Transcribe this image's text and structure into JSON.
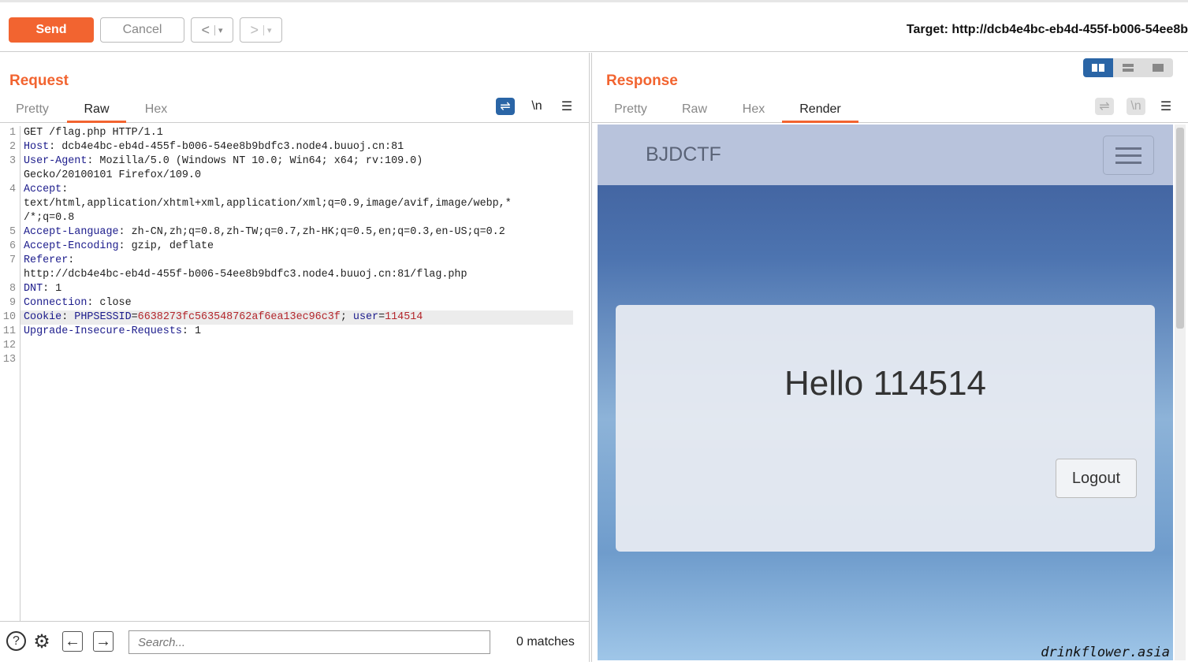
{
  "toolbar": {
    "send": "Send",
    "cancel": "Cancel",
    "back": "<",
    "forward": ">",
    "dropdown": "▾",
    "target": "Target: http://dcb4e4bc-eb4d-455f-b006-54ee8b"
  },
  "request": {
    "title": "Request",
    "tabs": [
      "Pretty",
      "Raw",
      "Hex"
    ],
    "active_tab": "Raw",
    "wrap_icon": "wrap-icon",
    "newline_label": "\\n",
    "menu_icon": "☰",
    "lines": [
      {
        "n": "1",
        "parts": [
          [
            "v",
            "GET /flag.php HTTP/1.1"
          ]
        ]
      },
      {
        "n": "2",
        "parts": [
          [
            "k",
            "Host"
          ],
          [
            "v",
            ": dcb4e4bc-eb4d-455f-b006-54ee8b9bdfc3.node4.buuoj.cn:81"
          ]
        ]
      },
      {
        "n": "3",
        "parts": [
          [
            "k",
            "User-Agent"
          ],
          [
            "v",
            ": Mozilla/5.0 (Windows NT 10.0; Win64; x64; rv:109.0)"
          ]
        ]
      },
      {
        "n": "",
        "parts": [
          [
            "v",
            "Gecko/20100101 Firefox/109.0"
          ]
        ]
      },
      {
        "n": "4",
        "parts": [
          [
            "k",
            "Accept"
          ],
          [
            "v",
            ":"
          ]
        ]
      },
      {
        "n": "",
        "parts": [
          [
            "v",
            "text/html,application/xhtml+xml,application/xml;q=0.9,image/avif,image/webp,*"
          ]
        ]
      },
      {
        "n": "",
        "parts": [
          [
            "v",
            "/*;q=0.8"
          ]
        ]
      },
      {
        "n": "5",
        "parts": [
          [
            "k",
            "Accept-Language"
          ],
          [
            "v",
            ": zh-CN,zh;q=0.8,zh-TW;q=0.7,zh-HK;q=0.5,en;q=0.3,en-US;q=0.2"
          ]
        ]
      },
      {
        "n": "6",
        "parts": [
          [
            "k",
            "Accept-Encoding"
          ],
          [
            "v",
            ": gzip, deflate"
          ]
        ]
      },
      {
        "n": "7",
        "parts": [
          [
            "k",
            "Referer"
          ],
          [
            "v",
            ":"
          ]
        ]
      },
      {
        "n": "",
        "parts": [
          [
            "v",
            "http://dcb4e4bc-eb4d-455f-b006-54ee8b9bdfc3.node4.buuoj.cn:81/flag.php"
          ]
        ]
      },
      {
        "n": "8",
        "parts": [
          [
            "k",
            "DNT"
          ],
          [
            "v",
            ": 1"
          ]
        ]
      },
      {
        "n": "9",
        "parts": [
          [
            "k",
            "Connection"
          ],
          [
            "v",
            ": close"
          ]
        ]
      },
      {
        "n": "10",
        "hl": true,
        "parts": [
          [
            "k",
            "Cookie"
          ],
          [
            "v",
            ": "
          ],
          [
            "k",
            "PHPSESSID"
          ],
          [
            "v",
            "="
          ],
          [
            "r",
            "6638273fc563548762af6ea13ec96c3f"
          ],
          [
            "v",
            "; "
          ],
          [
            "k",
            "user"
          ],
          [
            "v",
            "="
          ],
          [
            "r",
            "114514"
          ]
        ]
      },
      {
        "n": "11",
        "parts": [
          [
            "k",
            "Upgrade-Insecure-Requests"
          ],
          [
            "v",
            ": 1"
          ]
        ]
      },
      {
        "n": "12",
        "parts": []
      },
      {
        "n": "13",
        "parts": []
      }
    ]
  },
  "search": {
    "placeholder": "Search...",
    "matches": "0 matches"
  },
  "response": {
    "title": "Response",
    "tabs": [
      "Pretty",
      "Raw",
      "Hex",
      "Render"
    ],
    "active_tab": "Render",
    "newline_label": "\\n",
    "menu_icon": "☰",
    "render": {
      "brand": "BJDCTF",
      "hello": "Hello 114514",
      "logout": "Logout",
      "watermark": "drinkflower.asia"
    }
  },
  "colors": {
    "accent": "#f26430",
    "active_layout": "#2a65a6"
  }
}
